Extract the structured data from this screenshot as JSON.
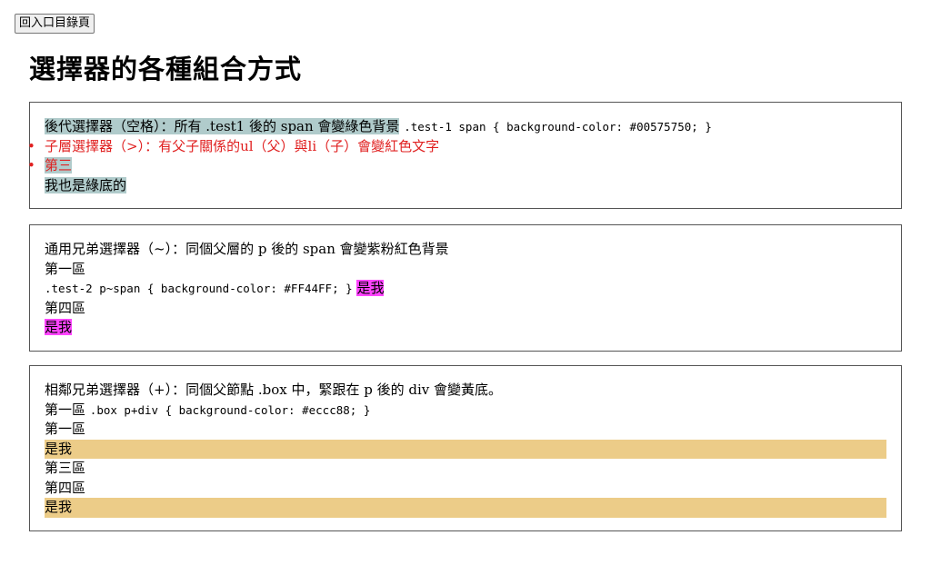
{
  "nav": {
    "back_label": "回入口目錄頁"
  },
  "page": {
    "title": "選擇器的各種組合方式"
  },
  "box1": {
    "descendant_text": "後代選擇器（空格）：所有 .test1 後的 span 會變綠色背景",
    "descendant_code": ".test-1 span { background-color: #00575750; }",
    "child_item_1": "子層選擇器（>）：有父子關係的ul（父）與li（子）會變紅色文字",
    "child_item_2": "第三",
    "also_green": "我也是綠底的"
  },
  "box2": {
    "title": "通用兄弟選擇器（~）：同個父層的 p 後的 span 會變紫粉紅色背景",
    "p1": "第一區",
    "code": ".test-2 p~span { background-color: #FF44FF; }",
    "span1": "是我",
    "p4": "第四區",
    "span2": "是我"
  },
  "box3": {
    "title": "相鄰兄弟選擇器（+）：同個父節點 .box 中，緊跟在 p 後的 div 會變黃底。",
    "line2_text": "第一區",
    "code": ".box p+div { background-color: #eccc88; }",
    "p1": "第一區",
    "div1": "是我",
    "p3": "第三區",
    "p4": "第四區",
    "div2": "是我"
  },
  "colors": {
    "green_bg": "#00575750",
    "red_text": "#e02020",
    "pink_bg": "#FF44FF",
    "yellow_bg": "#eccc88"
  }
}
